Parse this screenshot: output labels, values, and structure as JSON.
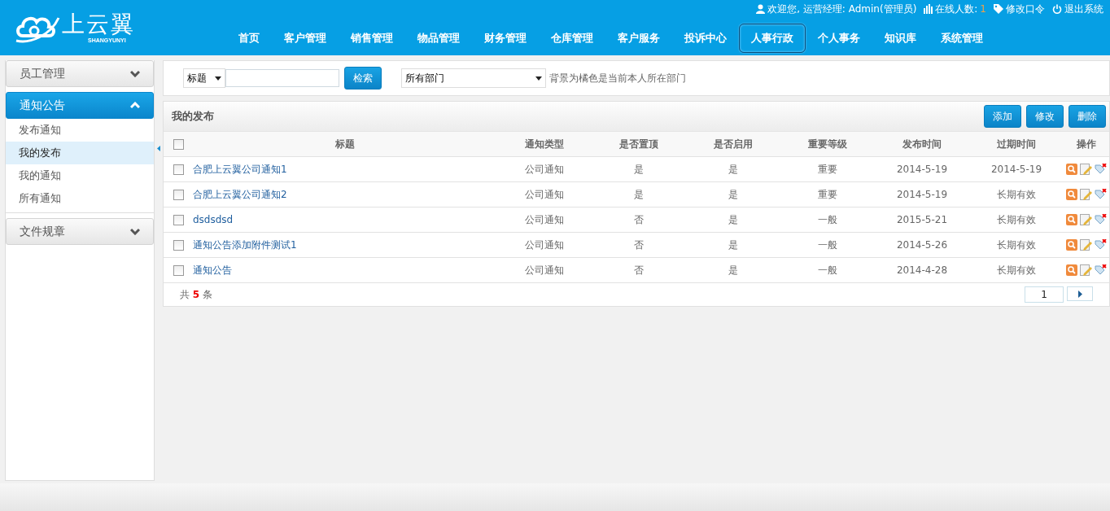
{
  "brand": {
    "name": "上云翼",
    "subtitle": "SHANGYUNYI"
  },
  "user_bar": {
    "welcome": "欢迎您, 运营经理: Admin(管理员)",
    "online_label": "在线人数:",
    "online_count": "1",
    "change_password": "修改口令",
    "logout": "退出系统"
  },
  "nav": [
    {
      "label": "首页",
      "selected": false
    },
    {
      "label": "客户管理",
      "selected": false
    },
    {
      "label": "销售管理",
      "selected": false
    },
    {
      "label": "物品管理",
      "selected": false
    },
    {
      "label": "财务管理",
      "selected": false
    },
    {
      "label": "仓库管理",
      "selected": false
    },
    {
      "label": "客户服务",
      "selected": false
    },
    {
      "label": "投诉中心",
      "selected": false
    },
    {
      "label": "人事行政",
      "selected": true
    },
    {
      "label": "个人事务",
      "selected": false
    },
    {
      "label": "知识库",
      "selected": false
    },
    {
      "label": "系统管理",
      "selected": false
    }
  ],
  "sidebar": [
    {
      "label": "员工管理",
      "expanded": false
    },
    {
      "label": "通知公告",
      "expanded": true,
      "children": [
        {
          "label": "发布通知",
          "selected": false
        },
        {
          "label": "我的发布",
          "selected": true
        },
        {
          "label": "我的通知",
          "selected": false
        },
        {
          "label": "所有通知",
          "selected": false
        }
      ]
    },
    {
      "label": "文件规章",
      "expanded": false
    }
  ],
  "search": {
    "field_select": "标题",
    "button": "检索",
    "department_select": "所有部门",
    "hint": "背景为橘色是当前本人所在部门"
  },
  "panel": {
    "title": "我的发布",
    "buttons": [
      "添加",
      "修改",
      "删除"
    ]
  },
  "table": {
    "select_all_checked": false,
    "columns": [
      "标题",
      "通知类型",
      "是否置顶",
      "是否启用",
      "重要等级",
      "发布时间",
      "过期时间",
      "操作"
    ],
    "rows": [
      {
        "checked": false,
        "cells": [
          "合肥上云翼公司通知1",
          "公司通知",
          "是",
          "是",
          "重要",
          "2014-5-19",
          "2014-5-19"
        ]
      },
      {
        "checked": false,
        "cells": [
          "合肥上云翼公司通知2",
          "公司通知",
          "是",
          "是",
          "重要",
          "2014-5-19",
          "长期有效"
        ]
      },
      {
        "checked": false,
        "cells": [
          "dsdsdsd",
          "公司通知",
          "否",
          "是",
          "一般",
          "2015-5-21",
          "长期有效"
        ]
      },
      {
        "checked": false,
        "cells": [
          "通知公告添加附件测试1",
          "公司通知",
          "否",
          "是",
          "一般",
          "2014-5-26",
          "长期有效"
        ]
      },
      {
        "checked": false,
        "cells": [
          "通知公告",
          "公司通知",
          "否",
          "是",
          "一般",
          "2014-4-28",
          "长期有效"
        ]
      }
    ]
  },
  "footer": {
    "total": "共 **5** 条",
    "page": "1"
  }
}
